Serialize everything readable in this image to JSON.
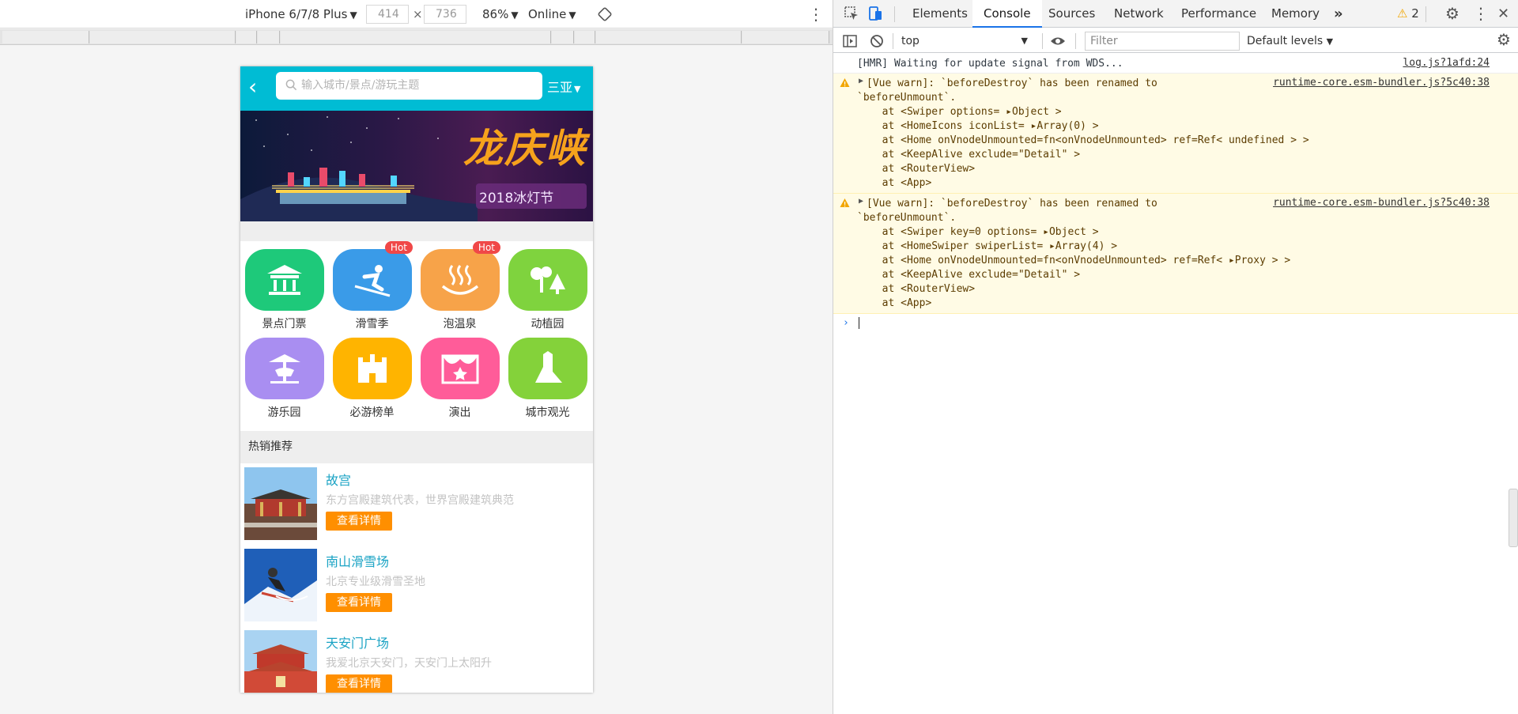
{
  "device_toolbar": {
    "device": "iPhone 6/7/8 Plus",
    "width": "414",
    "height": "736",
    "zoom": "86%",
    "network": "Online"
  },
  "phone": {
    "search_placeholder": "输入城市/景点/游玩主题",
    "city": "三亚",
    "banner": {
      "title": "龙庆峡",
      "subtitle": "2018冰灯节"
    },
    "icons": [
      {
        "label": "景点门票",
        "color": "#1ec97a",
        "icon": "pavilion-icon",
        "hot": ""
      },
      {
        "label": "滑雪季",
        "color": "#3a9be8",
        "icon": "skier-icon",
        "hot": "Hot"
      },
      {
        "label": "泡温泉",
        "color": "#f7a349",
        "icon": "hot-spring-icon",
        "hot": "Hot"
      },
      {
        "label": "动植园",
        "color": "#7fd33e",
        "icon": "trees-icon",
        "hot": ""
      },
      {
        "label": "游乐园",
        "color": "#a98ef1",
        "icon": "carousel-icon",
        "hot": ""
      },
      {
        "label": "必游榜单",
        "color": "#ffb400",
        "icon": "castle-icon",
        "hot": ""
      },
      {
        "label": "演出",
        "color": "#ff5c99",
        "icon": "theater-icon",
        "hot": ""
      },
      {
        "label": "城市观光",
        "color": "#84d23a",
        "icon": "landmark-icon",
        "hot": ""
      }
    ],
    "hot_title": "热销推荐",
    "recommendations": [
      {
        "title": "故宫",
        "desc": "东方宫殿建筑代表，世界宫殿建筑典范",
        "button": "查看详情"
      },
      {
        "title": "南山滑雪场",
        "desc": "北京专业级滑雪圣地",
        "button": "查看详情"
      },
      {
        "title": "天安门广场",
        "desc": "我爱北京天安门，天安门上太阳升",
        "button": "查看详情"
      }
    ]
  },
  "devtools": {
    "tabs": [
      "Elements",
      "Console",
      "Sources",
      "Network",
      "Performance",
      "Memory"
    ],
    "more": "»",
    "warning_count": "2",
    "context": "top",
    "filter_placeholder": "Filter",
    "levels": "Default levels",
    "messages": [
      {
        "type": "log",
        "source": "log.js?1afd:24",
        "lines": [
          "[HMR] Waiting for update signal from WDS..."
        ]
      },
      {
        "type": "warn",
        "source": "runtime-core.esm-bundler.js?5c40:38",
        "lines": [
          "[Vue warn]: `beforeDestroy` has been renamed to",
          "`beforeUnmount`.",
          "  at <Swiper options= ▸Object >",
          "  at <HomeIcons iconList= ▸Array(0) >",
          "  at <Home onVnodeUnmounted=fn<onVnodeUnmounted> ref=Ref< undefined > >",
          "  at <KeepAlive exclude=\"Detail\" >",
          "  at <RouterView>",
          "  at <App>"
        ]
      },
      {
        "type": "warn",
        "source": "runtime-core.esm-bundler.js?5c40:38",
        "lines": [
          "[Vue warn]: `beforeDestroy` has been renamed to",
          "`beforeUnmount`.",
          "  at <Swiper key=0 options= ▸Object >",
          "  at <HomeSwiper swiperList= ▸Array(4) >",
          "  at <Home onVnodeUnmounted=fn<onVnodeUnmounted> ref=Ref< ▸Proxy > >",
          "  at <KeepAlive exclude=\"Detail\" >",
          "  at <RouterView>",
          "  at <App>"
        ]
      }
    ],
    "prompt": "›"
  }
}
